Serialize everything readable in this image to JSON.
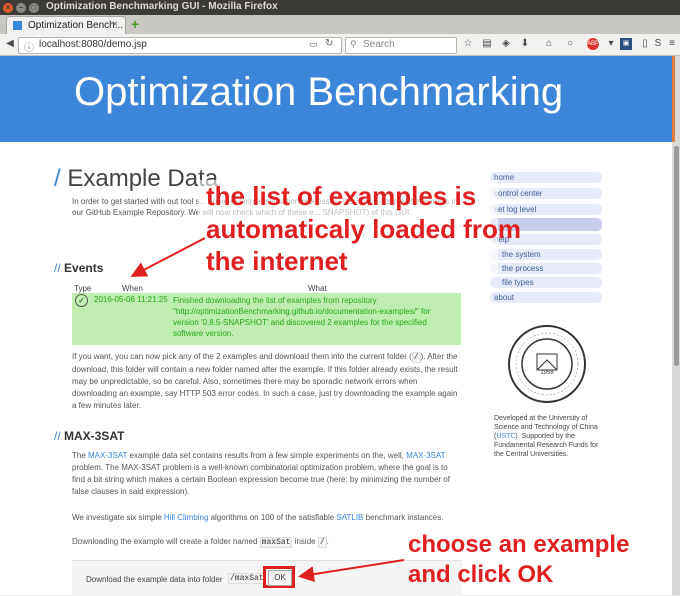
{
  "window": {
    "title": "Optimization Benchmarking GUI - Mozilla Firefox"
  },
  "tab": {
    "label": "Optimization Bench..."
  },
  "nav": {
    "url": "localhost:8080/demo.jsp",
    "search_placeholder": "Search"
  },
  "banner": {
    "title": "Optimization Benchmarking"
  },
  "main": {
    "heading": "Example Data",
    "intro": "In order to get started with out tool s... some example evaluation processes. We host a couple of examples in our GitHub Example Repository. We will now check which of these e... SNAPSHOT) of this GUI.",
    "events_heading": "Events",
    "events": {
      "columns": [
        "Type",
        "When",
        "What"
      ],
      "rows": [
        {
          "when": "2016-05-06 11:21:25",
          "what": "Finished downloading the list of examples from repository \"http://optimizationBenchmarking.github.io/documentation-examples/\" for version '0.8.5-SNAPSHOT' and discovered 2 examples for the specified software version."
        }
      ]
    },
    "after_events": {
      "p1": "If you want, you can now pick any of the 2 examples and download them into the current folder (",
      "code": "/",
      "p2": "). After the download, this folder will contain a new folder named after the example. If this folder already exists, the result may be unpredictable, so be careful. Also, sometimes there may be sporadic network errors when downloading an example, say HTTP 503 error codes. In such a case, just try downloading the example again a few minutes later."
    },
    "maxsat_heading": "MAX-3SAT",
    "maxsat": {
      "p1_a": "The ",
      "link1": "MAX-3SAT",
      "p1_b": " example data set contains results from a few simple experiments on the, well, ",
      "link2": "MAX-3SAT",
      "p1_c": " problem. The MAX-3SAT problem is a well-known combinatorial optimization problem, where the goal is to find a bit string which makes a certain Boolean expression become true (here: by minimizing the number of false clauses in said expression).",
      "p2_a": "We investigate six simple ",
      "link3": "Hill Climbing",
      "p2_b": " algorithms on 100 of the satisfiable ",
      "link4": "SATLIB",
      "p2_c": " benchmark instances.",
      "p3_a": "Downloading the example will create a folder named ",
      "folder": "maxSat",
      "p3_b": " inside ",
      "p3_code": "/",
      "p3_c": ".",
      "download_label": "Download the example data into folder",
      "download_path": "/maxSat",
      "ok_label": "OK"
    }
  },
  "sidebar": {
    "items": [
      "home",
      "control center",
      "set log level",
      "",
      "help",
      "the system",
      "the process",
      "file types",
      "about"
    ],
    "logo_text": "1958",
    "caption_a": "Developed at the University of Science and Technology of China (",
    "caption_link": "USTC",
    "caption_b": "). Supported by the Fundamental Research Funds for the Central Universities."
  },
  "annotations": {
    "top_lines": [
      "the list of examples is",
      "automaticaly loaded from",
      "the internet"
    ],
    "bottom_lines": [
      "choose an example",
      "and click OK"
    ]
  },
  "colors": {
    "accent": "#3b86d9",
    "annotation": "#e02020",
    "event_bg": "#bfeeb0",
    "event_text": "#22aa11"
  }
}
